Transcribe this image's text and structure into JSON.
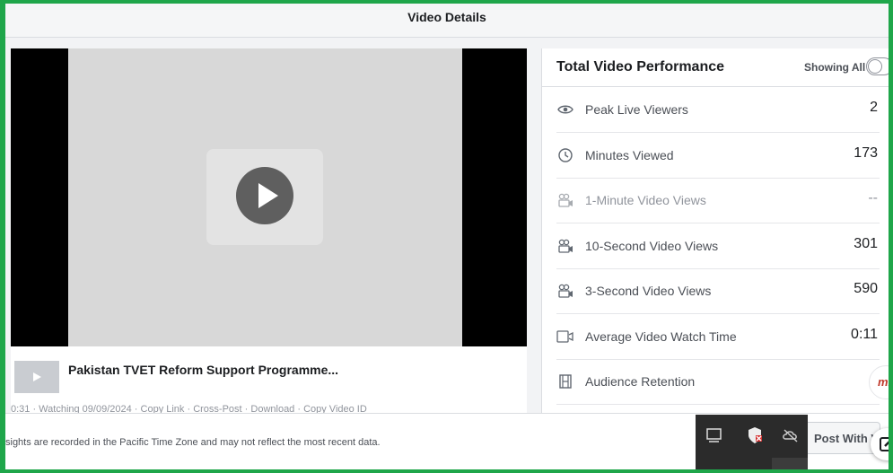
{
  "header": {
    "title": "Video Details"
  },
  "video": {
    "title": "Pakistan TVET Reform Support Programme...",
    "meta": "0:31 · Watching 09/09/2024 · Copy Link · Cross-Post · Download · Copy Video ID"
  },
  "performance": {
    "title": "Total Video Performance",
    "filter_label": "Showing All",
    "metrics": [
      {
        "label": "Peak Live Viewers",
        "value": "2",
        "icon": "eye-icon",
        "dim": false
      },
      {
        "label": "Minutes Viewed",
        "value": "173",
        "icon": "clock-icon",
        "dim": false
      },
      {
        "label": "1-Minute Video Views",
        "value": "--",
        "icon": "video-views-icon",
        "dim": true
      },
      {
        "label": "10-Second Video Views",
        "value": "301",
        "icon": "video-views-icon",
        "dim": false
      },
      {
        "label": "3-Second Video Views",
        "value": "590",
        "icon": "video-views-icon",
        "dim": false
      },
      {
        "label": "Average Video Watch Time",
        "value": "0:11",
        "icon": "video-camera-icon",
        "dim": false
      },
      {
        "label": "Audience Retention",
        "value": "",
        "icon": "film-strip-icon",
        "dim": false
      }
    ]
  },
  "footer": {
    "note": "sights are recorded in the Pacific Time Zone and may not reflect the most recent data.",
    "post_button_label": "Post With V"
  },
  "badge": {
    "text": "mi"
  },
  "colors": {
    "frame_border": "#1fa64a",
    "tray_bg": "#2b2b2b"
  }
}
